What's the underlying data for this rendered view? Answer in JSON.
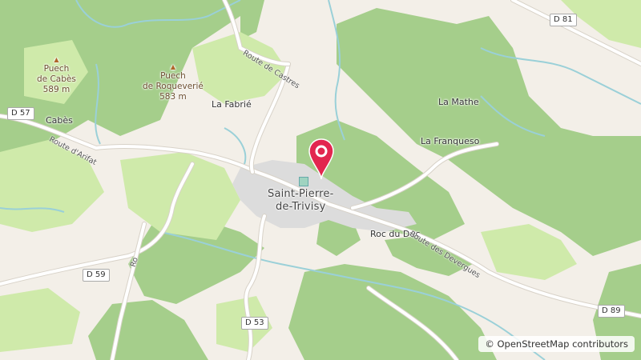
{
  "colors": {
    "forest": "#a5ce8b",
    "meadow": "#cfeaaa",
    "background": "#f3efe8",
    "urban": "#dcdcdc",
    "water": "#9ad0d8",
    "road": "#ffffff",
    "pin": "#e2264f"
  },
  "map": {
    "town": {
      "line1": "Saint-Pierre-",
      "line2": "de-Trivisy"
    },
    "peaks": [
      {
        "name": "Puech\nde Cabès",
        "line1": "Puech",
        "line2": "de Cabès",
        "ele": "589 m"
      },
      {
        "name": "Puech\nde Roqueverié",
        "line1": "Puech",
        "line2": "de Roqueverié",
        "ele": "583 m"
      }
    ],
    "places": {
      "la_fabrie": "La Fabrié",
      "cabes": "Cabès",
      "la_mathe": "La Mathe",
      "la_franqueso": "La Franqueso",
      "roc_du_duc": "Roc du Duc"
    },
    "road_names": {
      "route_de_castres": "Route de Castres",
      "route_darifat": "Route d'Arifat",
      "route_des_devergues": "Route des Devergues",
      "route_partial": "Ro"
    },
    "road_refs": {
      "d81": "D 81",
      "d57": "D 57",
      "d59": "D 59",
      "d53": "D 53",
      "d89": "D 89"
    },
    "marker_icon": "map-pin-icon",
    "attribution": "© OpenStreetMap contributors"
  }
}
